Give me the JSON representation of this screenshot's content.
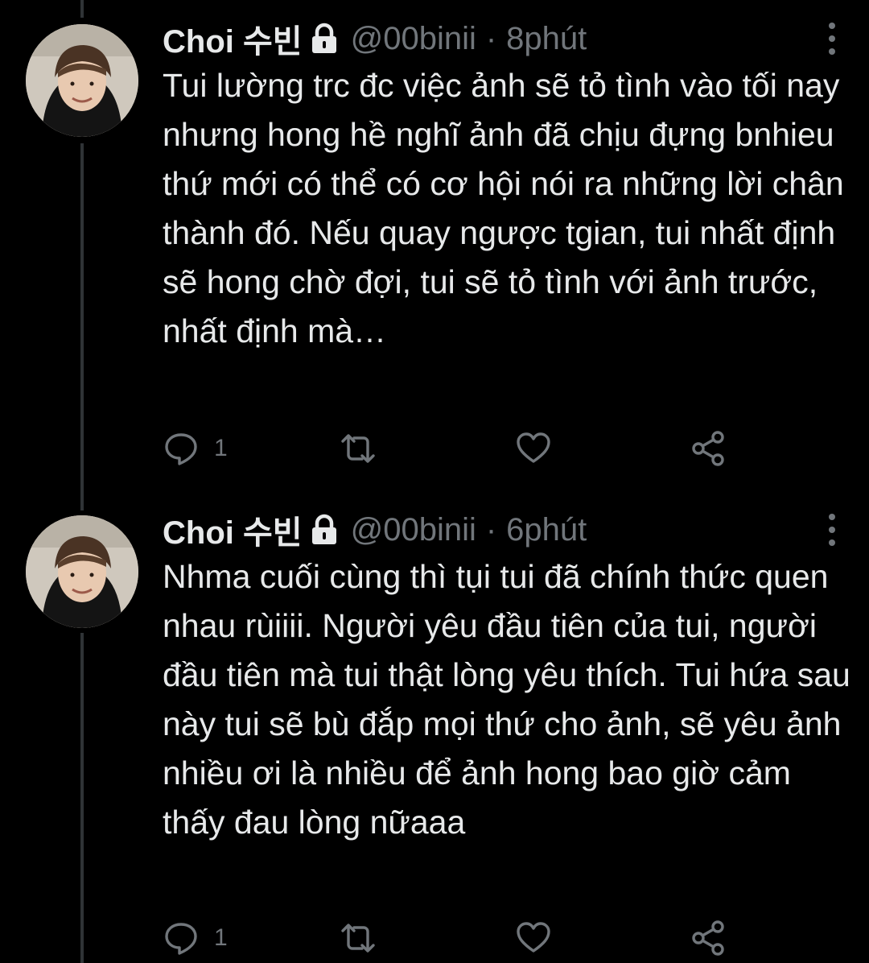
{
  "tweets": [
    {
      "display_name": "Choi 수빈",
      "handle": "@00binii",
      "separator": "·",
      "time": "8phút",
      "text": "Tui lường trc đc việc ảnh sẽ tỏ tình vào tối nay nhưng hong hề nghĩ ảnh đã chịu đựng bnhieu thứ mới có thể có cơ hội nói ra những lời chân thành đó. Nếu quay ngược tgian, tui nhất định sẽ hong chờ đợi, tui sẽ tỏ tình với ảnh trước, nhất định mà…",
      "reply_count": "1",
      "icons": [
        "avatar",
        "lock-icon",
        "more-icon",
        "reply-icon",
        "retweet-icon",
        "like-icon",
        "share-icon"
      ]
    },
    {
      "display_name": "Choi 수빈",
      "handle": "@00binii",
      "separator": "·",
      "time": "6phút",
      "text": "Nhma cuối cùng thì tụi tui đã chính thức quen nhau rùiiii. Người yêu đầu tiên của tui, người đầu tiên mà tui thật lòng yêu thích. Tui hứa sau này tui sẽ bù đắp mọi thứ cho ảnh, sẽ yêu ảnh nhiều ơi là nhiều để ảnh hong bao giờ cảm thấy đau lòng nữaaa",
      "reply_count": "1",
      "icons": [
        "avatar",
        "lock-icon",
        "more-icon",
        "reply-icon",
        "retweet-icon",
        "like-icon",
        "share-icon"
      ]
    }
  ],
  "colors": {
    "background": "#000000",
    "text_primary": "#e7e9ea",
    "text_secondary": "#71767b",
    "thread_line": "#2f3336"
  }
}
